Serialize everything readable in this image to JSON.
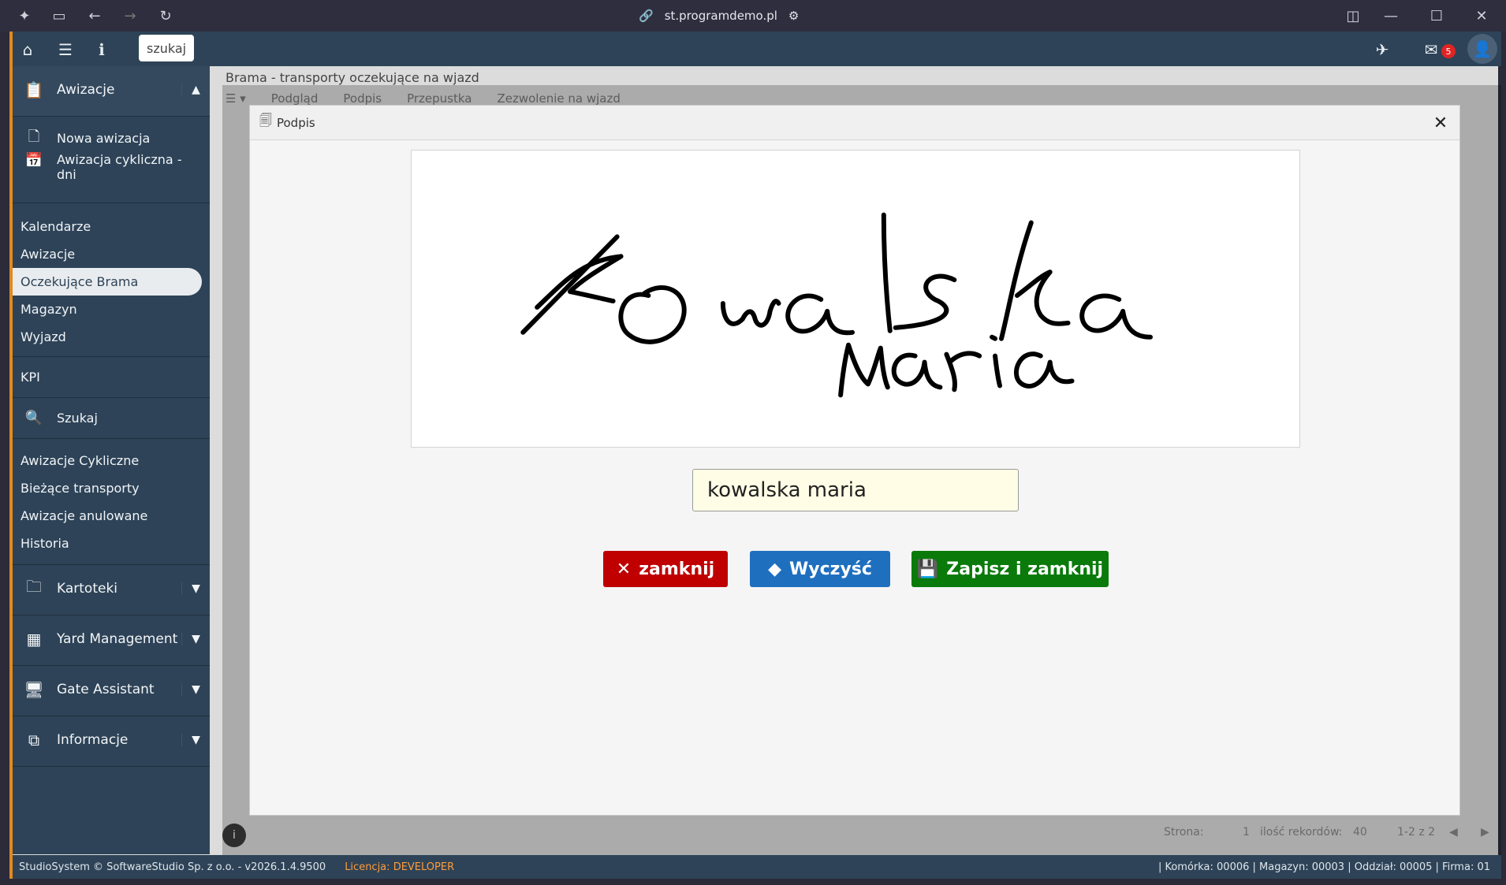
{
  "browser": {
    "url": "st.programdemo.pl"
  },
  "topbar": {
    "search_label": "szukaj",
    "mail_count": "5"
  },
  "sidebar": {
    "section_awizacje": "Awizacje",
    "nowa_awizacja": "Nowa awizacja",
    "awizacja_cykliczna": "Awizacja cykliczna - dni",
    "items_group1": [
      "Kalendarze",
      "Awizacje",
      "Oczekujące Brama",
      "Magazyn",
      "Wyjazd"
    ],
    "kpi": "KPI",
    "szukaj": "Szukaj",
    "items_group2": [
      "Awizacje Cykliczne",
      "Bieżące transporty",
      "Awizacje anulowane",
      "Historia"
    ],
    "kartoteki": "Kartoteki",
    "yard": "Yard Management",
    "gate": "Gate Assistant",
    "informacje": "Informacje"
  },
  "content": {
    "title": "Brama - transporty oczekujące na wjazd",
    "toolbar": [
      "Podgląd",
      "Podpis",
      "Przepustka",
      "Zezwolenie na wjazd"
    ],
    "pager_strona": "Strona:",
    "pager_page": "1",
    "pager_ilosc": "ilość rekordów:",
    "pager_count": "40",
    "pager_range": "1-2 z 2"
  },
  "footer": {
    "copyright": "StudioSystem © SoftwareStudio Sp. z o.o. - v2026.1.4.9500",
    "licence_label": "Licencja:",
    "licence_value": "DEVELOPER",
    "right_info": "| Komórka: 00006 | Magazyn: 00003 | Oddział: 00005 | Firma: 01"
  },
  "modal": {
    "title": "Podpis",
    "signature_input_value": "kowalska maria",
    "btn_close": "zamknij",
    "btn_clear": "Wyczyść",
    "btn_save": "Zapisz i zamknij"
  },
  "colors": {
    "sidebar_bg": "#2e4357",
    "accent_orange": "#e08a1e",
    "btn_close": "#c00000",
    "btn_clear": "#1f6fbf",
    "btn_save": "#0a7a0a",
    "input_bg": "#fffde6"
  }
}
